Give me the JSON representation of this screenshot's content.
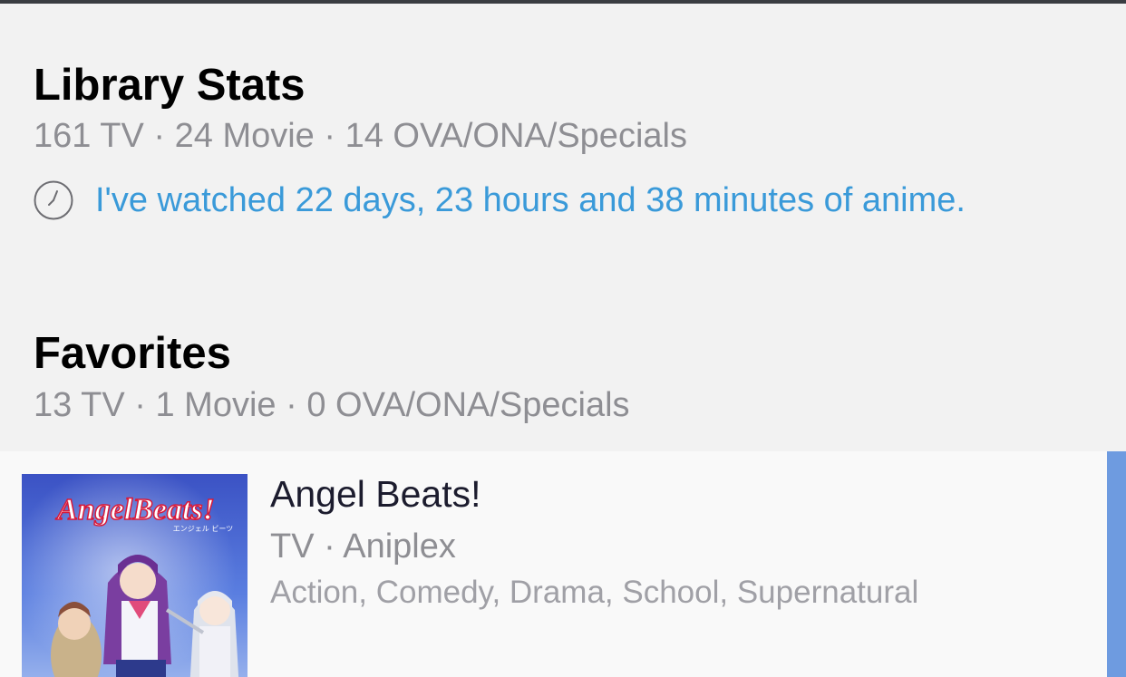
{
  "library": {
    "title": "Library Stats",
    "tv": "161 TV",
    "movie": "24 Movie",
    "ova": "14 OVA/ONA/Specials",
    "separator": "·",
    "watch_time": "I've watched 22 days, 23 hours and 38 minutes of anime."
  },
  "favorites": {
    "title": "Favorites",
    "tv": "13 TV",
    "movie": "1 Movie",
    "ova": "0 OVA/ONA/Specials",
    "separator": "·",
    "items": [
      {
        "title": "Angel Beats!",
        "type": "TV",
        "studio": "Aniplex",
        "separator": "·",
        "genres": "Action, Comedy, Drama, School, Supernatural",
        "cover_logo": "AngelBeats!",
        "cover_logo_jp": "エンジェル ビーツ"
      }
    ]
  },
  "icons": {
    "clock": "clock-icon"
  },
  "colors": {
    "background": "#f2f2f2",
    "accent_link": "#3a9ad9",
    "accent_bar": "#6e9be0",
    "top_bar": "#3a3d42"
  }
}
